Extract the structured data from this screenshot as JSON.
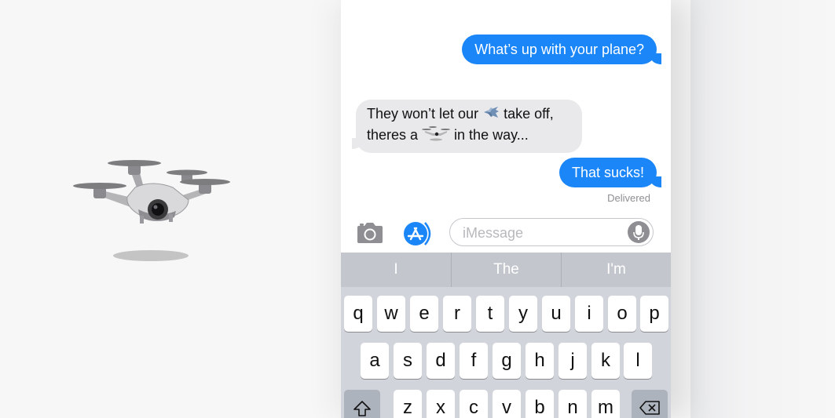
{
  "conversation": {
    "messages": [
      {
        "from": "me",
        "text": "What’s up with your plane?"
      },
      {
        "from": "them",
        "line1_prefix": "They won’t let our ",
        "line1_icon": "airplane-emoji",
        "line1_suffix": " take off,",
        "line2_prefix": "theres a ",
        "line2_icon": "drone-emoji",
        "line2_suffix": " in the way..."
      },
      {
        "from": "me",
        "text": "That sucks!"
      }
    ],
    "status": "Delivered"
  },
  "input": {
    "placeholder": "iMessage",
    "camera_icon": "camera-icon",
    "appstore_icon": "app-store-icon",
    "mic_icon": "microphone-icon"
  },
  "keyboard": {
    "suggestions": [
      "I",
      "The",
      "I'm"
    ],
    "row1": [
      "q",
      "w",
      "e",
      "r",
      "t",
      "y",
      "u",
      "i",
      "o",
      "p"
    ],
    "row2": [
      "a",
      "s",
      "d",
      "f",
      "g",
      "h",
      "j",
      "k",
      "l"
    ],
    "row3": [
      "z",
      "x",
      "c",
      "v",
      "b",
      "n",
      "m"
    ],
    "shift_icon": "shift-icon",
    "delete_icon": "delete-icon"
  },
  "colors": {
    "sent_bubble": "#1b86f8",
    "received_bubble": "#e9e9eb",
    "keyboard_bg": "#d1d4da"
  },
  "decor": {
    "large_drone_icon": "drone-emoji"
  }
}
